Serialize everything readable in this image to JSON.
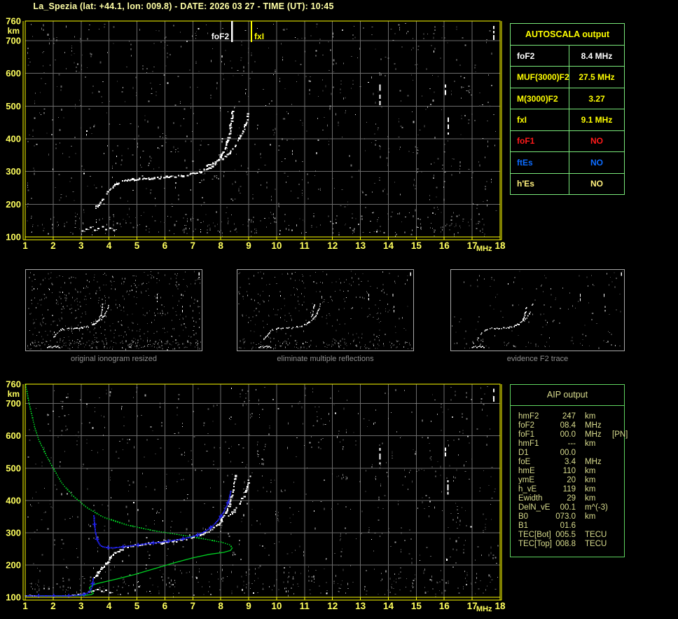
{
  "header": {
    "title": "La_Spezia (lat: +44.1, lon: 009.8) - DATE: 2026 03 27 - TIME (UT): 10:45"
  },
  "autoscala": {
    "title": "AUTOSCALA output",
    "rows": [
      {
        "label": "foF2",
        "value": "8.4 MHz",
        "color": "#ffffff"
      },
      {
        "label": "MUF(3000)F2",
        "value": "27.5 MHz",
        "color": "#ffff00"
      },
      {
        "label": "M(3000)F2",
        "value": "3.27",
        "color": "#ffff00"
      },
      {
        "label": "fxI",
        "value": "9.1 MHz",
        "color": "#ffff00"
      },
      {
        "label": "foF1",
        "value": "NO",
        "color": "#ff1a1a"
      },
      {
        "label": "ftEs",
        "value": "NO",
        "color": "#0c6cff"
      },
      {
        "label": "h'Es",
        "value": "NO",
        "color": "#fff07d"
      }
    ]
  },
  "aip": {
    "title": "AIP output",
    "rows": [
      {
        "label": "hmF2",
        "value": "247",
        "unit": "km",
        "extra": ""
      },
      {
        "label": "foF2",
        "value": "08.4",
        "unit": "MHz",
        "extra": ""
      },
      {
        "label": "foF1",
        "value": "00.0",
        "unit": "MHz",
        "extra": "[PN]"
      },
      {
        "label": "hmF1",
        "value": "---",
        "unit": "km",
        "extra": ""
      },
      {
        "label": "D1",
        "value": "00.0",
        "unit": "",
        "extra": ""
      },
      {
        "label": "foE",
        "value": "3.4",
        "unit": "MHz",
        "extra": ""
      },
      {
        "label": "hmE",
        "value": "110",
        "unit": "km",
        "extra": ""
      },
      {
        "label": "ymE",
        "value": "20",
        "unit": "km",
        "extra": ""
      },
      {
        "label": "h_vE",
        "value": "119",
        "unit": "km",
        "extra": ""
      },
      {
        "label": "Ewidth",
        "value": "29",
        "unit": "km",
        "extra": ""
      },
      {
        "label": "DelN_vE",
        "value": "00.1",
        "unit": "m^(-3)",
        "extra": ""
      },
      {
        "label": "B0",
        "value": "073.0",
        "unit": "km",
        "extra": ""
      },
      {
        "label": "B1",
        "value": "01.6",
        "unit": "",
        "extra": ""
      },
      {
        "label": "TEC[Bot]",
        "value": "005.5",
        "unit": "TECU",
        "extra": ""
      },
      {
        "label": "TEC[Top]",
        "value": "008.8",
        "unit": "TECU",
        "extra": ""
      }
    ]
  },
  "thumbnails": [
    {
      "caption": "original ionogram resized",
      "noise": 640,
      "seed": 101
    },
    {
      "caption": "eliminate multiple reflections",
      "noise": 390,
      "seed": 202
    },
    {
      "caption": "evidence F2 trace",
      "noise": 150,
      "seed": 303
    }
  ],
  "chart_data": [
    {
      "type": "scatter",
      "name": "autoscala-ionogram",
      "title": "scaled ionogram with AUTOSCALA characteristics",
      "xlabel": "MHz",
      "ylabel": "km",
      "xlim": [
        1,
        18
      ],
      "ylim": [
        100,
        760
      ],
      "x_ticks": [
        1,
        2,
        3,
        4,
        5,
        6,
        7,
        8,
        9,
        10,
        11,
        12,
        13,
        14,
        15,
        16,
        17,
        18
      ],
      "y_ticks": [
        760,
        700,
        600,
        500,
        400,
        300,
        200,
        100
      ],
      "grid": true,
      "markers": [
        {
          "label": "foF2",
          "x": 8.4,
          "color": "#ffffff",
          "side": "left"
        },
        {
          "label": "fxI",
          "x": 9.1,
          "color": "#ffff00",
          "side": "right"
        }
      ],
      "o_trace": [
        [
          3.52,
          188
        ],
        [
          3.62,
          197
        ],
        [
          3.72,
          207
        ],
        [
          3.82,
          218
        ],
        [
          3.92,
          230
        ],
        [
          4.02,
          242
        ],
        [
          4.14,
          252
        ],
        [
          4.28,
          261
        ],
        [
          4.45,
          268
        ],
        [
          4.65,
          273
        ],
        [
          4.9,
          276
        ],
        [
          5.2,
          277
        ],
        [
          5.5,
          279
        ],
        [
          5.8,
          280
        ],
        [
          6.1,
          282
        ],
        [
          6.4,
          284
        ],
        [
          6.7,
          287
        ],
        [
          6.95,
          291
        ],
        [
          7.2,
          297
        ],
        [
          7.45,
          305
        ],
        [
          7.65,
          314
        ],
        [
          7.85,
          328
        ],
        [
          8.0,
          344
        ],
        [
          8.12,
          362
        ],
        [
          8.22,
          383
        ],
        [
          8.3,
          407
        ],
        [
          8.36,
          432
        ],
        [
          8.4,
          458
        ],
        [
          8.43,
          482
        ]
      ],
      "x_trace": [
        [
          7.5,
          317
        ],
        [
          7.7,
          323
        ],
        [
          7.9,
          331
        ],
        [
          8.1,
          342
        ],
        [
          8.3,
          356
        ],
        [
          8.48,
          373
        ],
        [
          8.64,
          393
        ],
        [
          8.77,
          414
        ],
        [
          8.87,
          436
        ],
        [
          8.95,
          458
        ],
        [
          9.0,
          478
        ]
      ],
      "e_trace": [
        [
          3.05,
          118
        ],
        [
          3.2,
          124
        ],
        [
          3.35,
          129
        ],
        [
          3.5,
          120
        ],
        [
          3.62,
          126
        ],
        [
          3.78,
          131
        ],
        [
          3.9,
          122
        ],
        [
          4.05,
          127
        ],
        [
          4.18,
          120
        ]
      ],
      "streaks": [
        [
          13.7,
          498,
          566
        ],
        [
          16.05,
          528,
          566
        ],
        [
          16.15,
          413,
          465
        ],
        [
          17.77,
          698,
          745
        ]
      ],
      "noise": {
        "seed": 7,
        "count": 950
      }
    },
    {
      "type": "scatter",
      "name": "aip-ionogram",
      "title": "ionogram with restored trace and electron density profile",
      "xlabel": "MHz",
      "ylabel": "km",
      "xlim": [
        1,
        18
      ],
      "ylim": [
        100,
        760
      ],
      "x_ticks": [
        1,
        2,
        3,
        4,
        5,
        6,
        7,
        8,
        9,
        10,
        11,
        12,
        13,
        14,
        15,
        16,
        17,
        18
      ],
      "y_ticks": [
        760,
        700,
        600,
        500,
        400,
        300,
        200,
        100
      ],
      "grid": true,
      "o_trace": [
        [
          3.5,
          163
        ],
        [
          3.62,
          176
        ],
        [
          3.75,
          190
        ],
        [
          3.88,
          203
        ],
        [
          4.0,
          215
        ],
        [
          4.12,
          227
        ],
        [
          4.26,
          238
        ],
        [
          4.42,
          247
        ],
        [
          4.6,
          254
        ],
        [
          4.85,
          259
        ],
        [
          5.15,
          263
        ],
        [
          5.5,
          266
        ],
        [
          5.85,
          269
        ],
        [
          6.2,
          272
        ],
        [
          6.5,
          276
        ],
        [
          6.8,
          281
        ],
        [
          7.05,
          287
        ],
        [
          7.3,
          294
        ],
        [
          7.55,
          304
        ],
        [
          7.75,
          315
        ],
        [
          7.95,
          330
        ],
        [
          8.1,
          347
        ],
        [
          8.22,
          366
        ],
        [
          8.32,
          388
        ],
        [
          8.4,
          412
        ],
        [
          8.46,
          438
        ],
        [
          8.51,
          462
        ],
        [
          8.54,
          478
        ]
      ],
      "x_trace": [
        [
          7.9,
          322
        ],
        [
          8.1,
          334
        ],
        [
          8.3,
          349
        ],
        [
          8.5,
          367
        ],
        [
          8.68,
          388
        ],
        [
          8.82,
          411
        ],
        [
          8.92,
          434
        ],
        [
          9.0,
          457
        ],
        [
          9.05,
          476
        ]
      ],
      "e_trace": [
        [
          1.05,
          104
        ],
        [
          1.18,
          105
        ],
        [
          1.3,
          104
        ],
        [
          2.7,
          106
        ],
        [
          2.9,
          109
        ],
        [
          3.1,
          112
        ],
        [
          3.28,
          116
        ],
        [
          3.45,
          120
        ],
        [
          3.6,
          124
        ],
        [
          3.75,
          118
        ],
        [
          3.9,
          122
        ],
        [
          4.05,
          114
        ]
      ],
      "streaks": [
        [
          13.7,
          500,
          562
        ],
        [
          16.05,
          528,
          564
        ],
        [
          16.13,
          413,
          463
        ],
        [
          17.77,
          700,
          746
        ]
      ],
      "profile_color": "#00cf22",
      "profile_topside": [
        [
          1.02,
          758
        ],
        [
          1.1,
          716
        ],
        [
          1.2,
          678
        ],
        [
          1.33,
          630
        ],
        [
          1.5,
          585
        ],
        [
          1.75,
          540
        ],
        [
          2.0,
          500
        ],
        [
          2.3,
          455
        ],
        [
          2.7,
          415
        ],
        [
          3.2,
          378
        ],
        [
          3.8,
          348
        ],
        [
          4.6,
          325
        ],
        [
          5.5,
          308
        ],
        [
          6.5,
          294
        ],
        [
          7.4,
          281
        ],
        [
          8.0,
          271
        ],
        [
          8.3,
          263
        ],
        [
          8.42,
          254
        ]
      ],
      "profile_bottomside": [
        [
          8.42,
          254
        ],
        [
          8.35,
          245
        ],
        [
          8.1,
          239
        ],
        [
          7.6,
          233
        ],
        [
          7.0,
          222
        ],
        [
          6.3,
          206
        ],
        [
          5.6,
          188
        ],
        [
          4.9,
          170
        ],
        [
          4.3,
          157
        ],
        [
          3.85,
          148
        ],
        [
          3.55,
          142
        ],
        [
          3.38,
          136
        ],
        [
          3.3,
          130
        ],
        [
          3.32,
          124
        ],
        [
          3.4,
          118
        ],
        [
          3.44,
          112
        ],
        [
          3.36,
          108
        ],
        [
          3.15,
          106
        ],
        [
          2.8,
          105
        ],
        [
          2.3,
          104
        ],
        [
          1.6,
          104
        ],
        [
          1.0,
          104
        ]
      ],
      "blue_color": "#2020e6",
      "blue_trace_e": [
        [
          1.0,
          104
        ],
        [
          1.6,
          104
        ],
        [
          2.2,
          104
        ],
        [
          2.7,
          105
        ],
        [
          3.0,
          107
        ],
        [
          3.15,
          110
        ],
        [
          3.26,
          114
        ],
        [
          3.33,
          120
        ],
        [
          3.38,
          128
        ],
        [
          3.41,
          138
        ],
        [
          3.43,
          150
        ],
        [
          3.44,
          162
        ]
      ],
      "blue_trace_f": [
        [
          3.46,
          352
        ],
        [
          3.48,
          328
        ],
        [
          3.51,
          305
        ],
        [
          3.55,
          286
        ],
        [
          3.6,
          272
        ],
        [
          3.67,
          263
        ],
        [
          3.77,
          257
        ],
        [
          3.9,
          254
        ],
        [
          4.08,
          253
        ],
        [
          4.3,
          254
        ],
        [
          4.55,
          257
        ],
        [
          4.85,
          260
        ],
        [
          5.2,
          264
        ],
        [
          5.55,
          268
        ],
        [
          5.9,
          271
        ],
        [
          6.25,
          275
        ],
        [
          6.6,
          280
        ],
        [
          6.9,
          286
        ],
        [
          7.15,
          292
        ],
        [
          7.4,
          302
        ],
        [
          7.6,
          313
        ],
        [
          7.8,
          328
        ],
        [
          7.97,
          346
        ],
        [
          8.1,
          363
        ],
        [
          8.2,
          380
        ],
        [
          8.28,
          398
        ],
        [
          8.33,
          415
        ],
        [
          8.36,
          430
        ]
      ],
      "noise": {
        "seed": 13,
        "count": 900
      }
    }
  ]
}
